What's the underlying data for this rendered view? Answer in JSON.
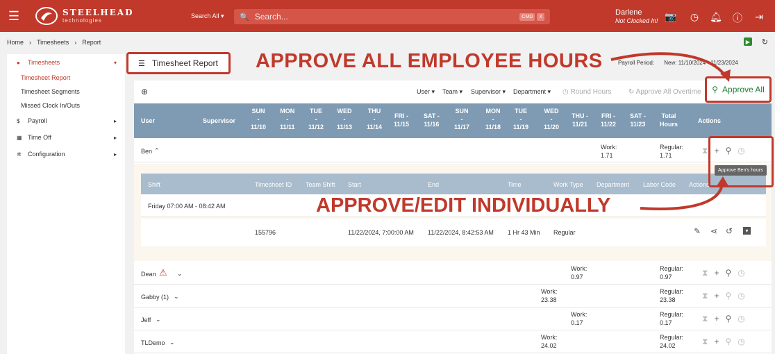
{
  "topbar": {
    "brand": "STEELHEAD",
    "brand_sub": "technologies",
    "search_scope": "Search All",
    "search_placeholder": "Search...",
    "kbd_cmd": "CMD",
    "kbd_x": "X",
    "user_name": "Darlene",
    "user_status": "Not Clocked In!"
  },
  "breadcrumb": [
    "Home",
    "Timesheets",
    "Report"
  ],
  "sidebar": {
    "timesheets": "Timesheets",
    "sub": [
      "Timesheet Report",
      "Timesheet Segments",
      "Missed Clock In/Outs"
    ],
    "payroll": "Payroll",
    "time_off": "Time Off",
    "configuration": "Configuration"
  },
  "page": {
    "title": "Timesheet Report",
    "payroll_label": "Payroll Period:",
    "payroll_value": "New: 11/10/2024 - 11/23/2024"
  },
  "annotations": {
    "top": "APPROVE ALL EMPLOYEE HOURS",
    "middle": "APPROVE/EDIT INDIVIDUALLY"
  },
  "filters": {
    "user": "User",
    "team": "Team",
    "supervisor": "Supervisor",
    "department": "Department",
    "round_hours": "Round Hours",
    "approve_all_overtime": "Approve All Overtime",
    "approve_all": "Approve All"
  },
  "table_head": {
    "user": "User",
    "supervisor": "Supervisor",
    "days": [
      [
        "SUN",
        "-",
        "11/10"
      ],
      [
        "MON",
        "-",
        "11/11"
      ],
      [
        "TUE",
        "-",
        "11/12"
      ],
      [
        "WED",
        "-",
        "11/13"
      ],
      [
        "THU",
        "-",
        "11/14"
      ],
      [
        "FRI -",
        "11/15"
      ],
      [
        "SAT -",
        "11/16"
      ],
      [
        "SUN",
        "-",
        "11/17"
      ],
      [
        "MON",
        "-",
        "11/18"
      ],
      [
        "TUE",
        "-",
        "11/19"
      ],
      [
        "WED",
        "-",
        "11/20"
      ],
      [
        "THU -",
        "11/21"
      ],
      [
        "FRI -",
        "11/22"
      ],
      [
        "SAT -",
        "11/23"
      ]
    ],
    "total": [
      "Total",
      "Hours"
    ],
    "actions": "Actions"
  },
  "ben": {
    "name": "Ben",
    "work_label": "Work:",
    "work": "1.71",
    "regular_label": "Regular:",
    "regular": "1.71",
    "tooltip": "Approve Ben's hours"
  },
  "detail": {
    "headers": [
      "Shift",
      "Timesheet ID",
      "Team Shift",
      "Start",
      "End",
      "Time",
      "Work Type",
      "Department",
      "Labor Code",
      "Actions"
    ],
    "shift": "Friday 07:00 AM - 08:42 AM",
    "timesheet_id": "155796",
    "start": "11/22/2024, 7:00:00 AM",
    "end": "11/22/2024, 8:42:53 AM",
    "time": "1 Hr 43 Min",
    "work_type": "Regular"
  },
  "rows": [
    {
      "name": "Dean",
      "work_label": "Work:",
      "work": "0.97",
      "regular_label": "Regular:",
      "regular": "0.97"
    },
    {
      "name": "Gabby (1)",
      "work_label": "Work:",
      "work": "23.38",
      "regular_label": "Regular:",
      "regular": "23.38"
    },
    {
      "name": "Jeff",
      "work_label": "Work:",
      "work": "0.17",
      "regular_label": "Regular:",
      "regular": "0.17"
    },
    {
      "name": "TLDemo",
      "work_label": "Work:",
      "work": "24.02",
      "regular_label": "Regular:",
      "regular": "24.02"
    }
  ],
  "colors": {
    "brand": "#c0392b",
    "header": "#7f9bb3",
    "approve": "#1e7e34"
  }
}
